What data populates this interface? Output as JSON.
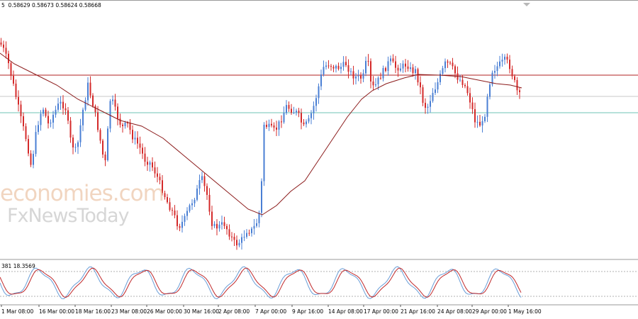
{
  "header": {
    "ohlc_text": "5  0.58629 0.58673 0.58624 0.58668",
    "oscillator_text": "381 18.3569"
  },
  "watermark": {
    "line1": "economies.com",
    "line2": "FxNewsToday"
  },
  "colors": {
    "bull": "#4a7fd4",
    "bear": "#d42a2a",
    "ma": "#8b1a1a",
    "resistance": "#b22222",
    "support": "#6fc3b6",
    "mid_line": "#c8c8c8",
    "stoch_main": "#6a9ed8",
    "stoch_signal": "#c0282a"
  },
  "chart_data": {
    "type": "candlestick",
    "x_labels": [
      "1 Mar 08:00",
      "16 Mar 00:00",
      "18 Mar 16:00",
      "23 Mar 08:00",
      "26 Mar 00:00",
      "30 Mar 16:00",
      "2 Apr 08:00",
      "7 Apr 00:00",
      "9 Apr 16:00",
      "14 Apr 08:00",
      "17 Apr 00:00",
      "21 Apr 16:00",
      "24 Apr 08:00",
      "29 Apr 00:00",
      "1 May 16:00"
    ],
    "last_price": 0.58668,
    "last_bar": {
      "open": 0.58629,
      "high": 0.58673,
      "low": 0.58624,
      "close": 0.58668
    },
    "horizontal_lines": [
      {
        "name": "resistance"
      },
      {
        "name": "mid-reference"
      },
      {
        "name": "support"
      }
    ],
    "oscillator": {
      "type": "stochastic",
      "value": 18.3569,
      "levels": [
        20,
        80
      ]
    }
  }
}
